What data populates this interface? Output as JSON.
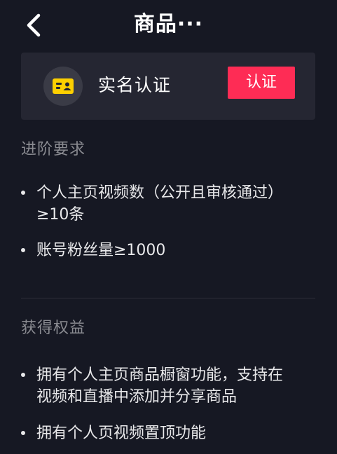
{
  "header": {
    "title": "商品···",
    "back_icon": "chevron-left-icon"
  },
  "auth_card": {
    "icon": "id-card-icon",
    "label": "实名认证",
    "button_label": "认证",
    "button_color": "#fe2c55",
    "icon_color": "#fdd000"
  },
  "advanced_requirements": {
    "title": "进阶要求",
    "items": [
      {
        "text": "个人主页视频数（公开且审核通过）\n≥10条"
      },
      {
        "text": "账号粉丝量≥1000"
      }
    ]
  },
  "benefits": {
    "title": "获得权益",
    "items": [
      {
        "text": "拥有个人主页商品橱窗功能，支持在\n视频和直播中添加并分享商品"
      },
      {
        "text": "拥有个人页视频置顶功能"
      }
    ]
  },
  "colors": {
    "background": "#161823",
    "card": "#252632",
    "accent": "#fe2c55",
    "muted_text": "#8a8b91"
  }
}
